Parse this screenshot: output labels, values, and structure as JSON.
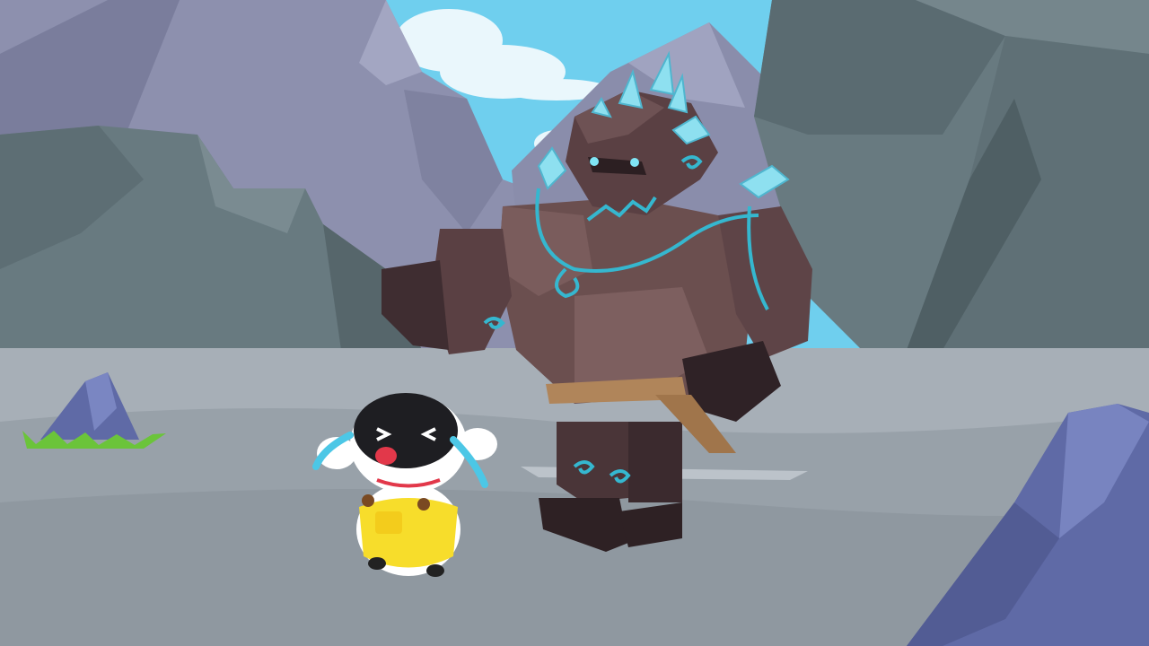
{
  "scene": {
    "description_hidden": "",
    "palette": {
      "sky": "#6fcfee",
      "cloud": "#e9f7fc",
      "mountain_light": "#8d90ae",
      "mountain_dark": "#6f7290",
      "cliff": "#687a80",
      "cliff_dark": "#56666b",
      "ground": "#a3acb4",
      "ground_dark": "#8e979f",
      "golem_stone": "#6b4f4f",
      "golem_dark": "#3f2d31",
      "crystal": "#7fd8ea",
      "rune": "#35b7cf",
      "rope": "#b0855a",
      "panda_overall": "#f7dd2b",
      "grass": "#6bc43a",
      "rock_blue": "#5f6aa6"
    },
    "characters": [
      "stone-golem",
      "crying-panda-baby"
    ]
  }
}
